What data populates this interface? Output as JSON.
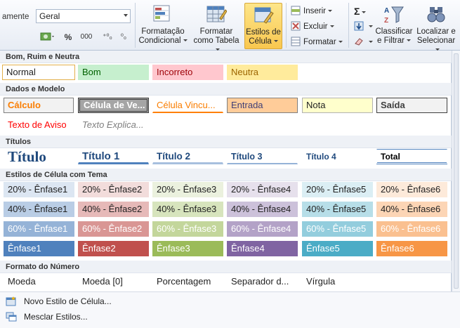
{
  "ribbon": {
    "cut_label": "amente",
    "number_format": "Geral",
    "percent_symbol": "%",
    "thousands_symbol": "000",
    "dec_increase": "⁺⁰₀",
    "dec_decrease": "⁰₀",
    "cond_format": [
      "Formatação",
      "Condicional"
    ],
    "format_table": [
      "Formatar",
      "como Tabela"
    ],
    "cell_styles": [
      "Estilos de",
      "Célula"
    ],
    "insert": "Inserir",
    "delete": "Excluir",
    "format": "Formatar",
    "sort_filter": [
      "Classificar",
      "e Filtrar"
    ],
    "find_select": [
      "Localizar e",
      "Selecionar"
    ]
  },
  "sections": {
    "good_bad": "Bom, Ruim e Neutra",
    "data_model": "Dados e Modelo",
    "titles": "Títulos",
    "themed": "Estilos de Célula com Tema",
    "number_format": "Formato do Número"
  },
  "good_bad_styles": [
    "Normal",
    "Bom",
    "Incorreto",
    "Neutra"
  ],
  "data_model_row1": [
    "Cálculo",
    "Célula de Ve...",
    "Célula Vincu...",
    "Entrada",
    "Nota",
    "Saída"
  ],
  "data_model_row2": [
    "Texto de Aviso",
    "Texto Explica..."
  ],
  "title_styles": [
    "Título",
    "Título 1",
    "Título 2",
    "Título 3",
    "Título 4",
    "Total"
  ],
  "themed_rows": [
    [
      "20% - Ênfase1",
      "20% - Ênfase2",
      "20% - Ênfase3",
      "20% - Ênfase4",
      "20% - Ênfase5",
      "20% - Ênfase6"
    ],
    [
      "40% - Ênfase1",
      "40% - Ênfase2",
      "40% - Ênfase3",
      "40% - Ênfase4",
      "40% - Ênfase5",
      "40% - Ênfase6"
    ],
    [
      "60% - Ênfase1",
      "60% - Ênfase2",
      "60% - Ênfase3",
      "60% - Ênfase4",
      "60% - Ênfase5",
      "60% - Ênfase6"
    ],
    [
      "Ênfase1",
      "Ênfase2",
      "Ênfase3",
      "Ênfase4",
      "Ênfase5",
      "Ênfase6"
    ]
  ],
  "number_styles": [
    "Moeda",
    "Moeda [0]",
    "Porcentagem",
    "Separador d...",
    "Vírgula"
  ],
  "menu": {
    "new_style": "Novo Estilo de Célula...",
    "merge_styles": "Mesclar Estilos..."
  },
  "colors": {
    "accent1": "#4f81bd",
    "accent2": "#c0504d",
    "accent3": "#9bbb59",
    "accent4": "#8064a2",
    "accent5": "#4bacc6",
    "accent6": "#f79646",
    "good_bg": "#c6efce",
    "bad_bg": "#ffc7ce",
    "neutral_bg": "#ffeb9c"
  }
}
